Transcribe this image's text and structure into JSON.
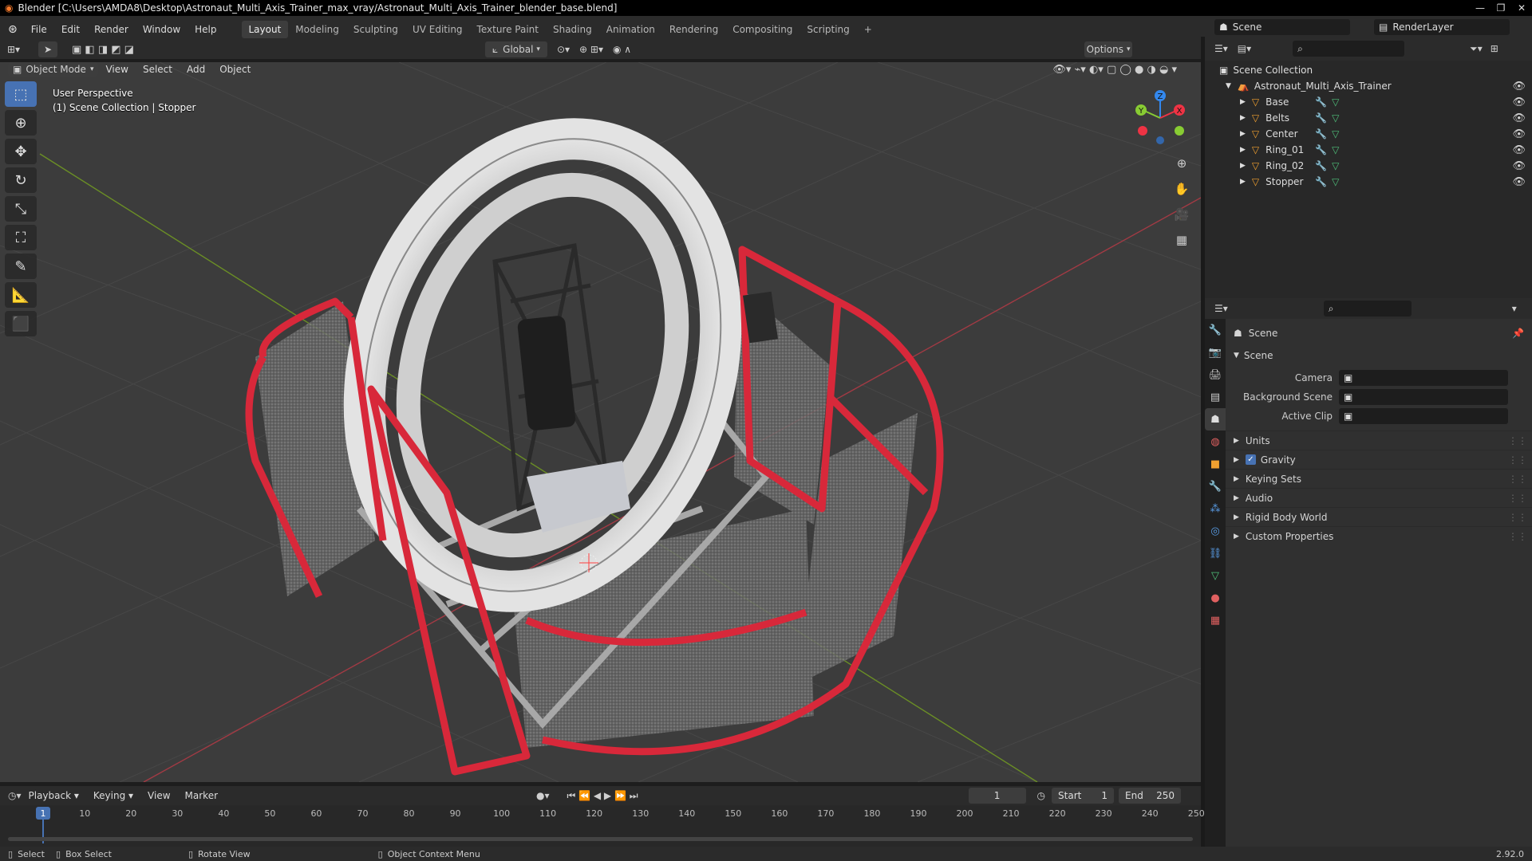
{
  "window": {
    "title": "Blender [C:\\Users\\AMDA8\\Desktop\\Astronaut_Multi_Axis_Trainer_max_vray/Astronaut_Multi_Axis_Trainer_blender_base.blend]",
    "controls": [
      "minimize-icon",
      "maximize-icon",
      "close-icon"
    ]
  },
  "menubar": {
    "menus": [
      "File",
      "Edit",
      "Render",
      "Window",
      "Help"
    ],
    "workspaces": [
      "Layout",
      "Modeling",
      "Sculpting",
      "UV Editing",
      "Texture Paint",
      "Shading",
      "Animation",
      "Rendering",
      "Compositing",
      "Scripting"
    ],
    "active_workspace": "Layout",
    "add_tab": "+",
    "scene_label": "Scene",
    "renderlayer_label": "RenderLayer"
  },
  "viewport_header": {
    "mode": "Object Mode",
    "menus": [
      "View",
      "Select",
      "Add",
      "Object"
    ],
    "orientation": "Global",
    "options": "Options"
  },
  "viewport": {
    "perspective": "User Perspective",
    "context": "(1) Scene Collection | Stopper",
    "gizmo_axes": [
      "X",
      "Y",
      "Z"
    ],
    "colors": {
      "x": "#ee3344",
      "y": "#88cc33",
      "z": "#3388ee",
      "grid": "#474747",
      "ring": "#cfcfcf",
      "frame": "#d8283a"
    }
  },
  "tools": [
    "select-box-icon",
    "cursor-icon",
    "move-icon",
    "rotate-icon",
    "scale-icon",
    "transform-icon",
    "annotate-icon",
    "measure-icon",
    "add-cube-icon"
  ],
  "outliner": {
    "root": "Scene Collection",
    "collection": "Astronaut_Multi_Axis_Trainer",
    "objects": [
      "Base",
      "Belts",
      "Center",
      "Ring_01",
      "Ring_02",
      "Stopper"
    ]
  },
  "properties": {
    "context": "Scene",
    "panel": "Scene",
    "fields": [
      {
        "label": "Camera",
        "value": ""
      },
      {
        "label": "Background Scene",
        "value": ""
      },
      {
        "label": "Active Clip",
        "value": ""
      }
    ],
    "sections": [
      {
        "label": "Units",
        "checkbox": false
      },
      {
        "label": "Gravity",
        "checkbox": true
      },
      {
        "label": "Keying Sets",
        "checkbox": false
      },
      {
        "label": "Audio",
        "checkbox": false
      },
      {
        "label": "Rigid Body World",
        "checkbox": false
      },
      {
        "label": "Custom Properties",
        "checkbox": false
      }
    ]
  },
  "timeline": {
    "menus": [
      "Playback",
      "Keying",
      "View",
      "Marker"
    ],
    "current_frame": "1",
    "start_label": "Start",
    "start": "1",
    "end_label": "End",
    "end": "250",
    "ticks": [
      "10",
      "20",
      "30",
      "40",
      "50",
      "60",
      "70",
      "80",
      "90",
      "100",
      "110",
      "120",
      "130",
      "140",
      "150",
      "160",
      "170",
      "180",
      "190",
      "200",
      "210",
      "220",
      "230",
      "240",
      "250"
    ],
    "playhead_label": "1"
  },
  "statusbar": {
    "select": "Select",
    "box_select": "Box Select",
    "rotate_view": "Rotate View",
    "context_menu": "Object Context Menu",
    "version": "2.92.0"
  }
}
